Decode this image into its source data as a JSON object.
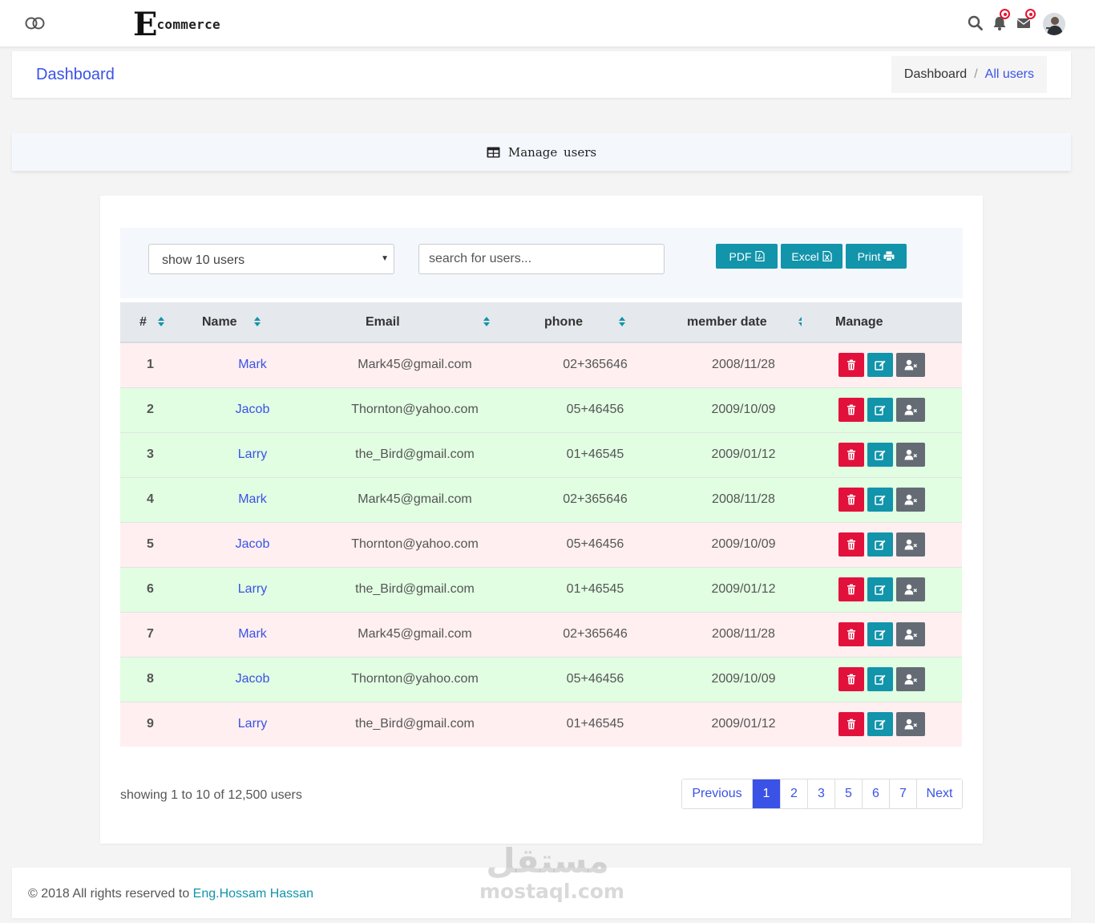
{
  "header": {
    "logo_letter": "E",
    "logo_text": "commerce",
    "icons": [
      "toggle-icon",
      "search-icon",
      "bell-icon",
      "envelope-icon",
      "avatar"
    ]
  },
  "titlebar": {
    "title": "Dashboard",
    "breadcrumb": {
      "home": "Dashboard",
      "separator": "/",
      "current": "All users"
    }
  },
  "section": {
    "title": "Manage users",
    "icon": "table-icon"
  },
  "controls": {
    "select_value": "show 10 users",
    "search_placeholder": "search for users...",
    "pdf_label": "PDF",
    "excel_label": "Excel",
    "print_label": "Print"
  },
  "table": {
    "columns": [
      "#",
      "Name",
      "Email",
      "phone",
      "member date",
      "Manage"
    ],
    "rows": [
      {
        "num": "1",
        "name": "Mark",
        "email": "Mark45@gmail.com",
        "phone": "02+365646",
        "date": "2008/11/28",
        "tint": "pink"
      },
      {
        "num": "2",
        "name": "Jacob",
        "email": "Thornton@yahoo.com",
        "phone": "05+46456",
        "date": "2009/10/09",
        "tint": "green"
      },
      {
        "num": "3",
        "name": "Larry",
        "email": "the_Bird@gmail.com",
        "phone": "01+46545",
        "date": "2009/01/12",
        "tint": "green"
      },
      {
        "num": "4",
        "name": "Mark",
        "email": "Mark45@gmail.com",
        "phone": "02+365646",
        "date": "2008/11/28",
        "tint": "green"
      },
      {
        "num": "5",
        "name": "Jacob",
        "email": "Thornton@yahoo.com",
        "phone": "05+46456",
        "date": "2009/10/09",
        "tint": "pink"
      },
      {
        "num": "6",
        "name": "Larry",
        "email": "the_Bird@gmail.com",
        "phone": "01+46545",
        "date": "2009/01/12",
        "tint": "green"
      },
      {
        "num": "7",
        "name": "Mark",
        "email": "Mark45@gmail.com",
        "phone": "02+365646",
        "date": "2008/11/28",
        "tint": "pink"
      },
      {
        "num": "8",
        "name": "Jacob",
        "email": "Thornton@yahoo.com",
        "phone": "05+46456",
        "date": "2009/10/09",
        "tint": "green"
      },
      {
        "num": "9",
        "name": "Larry",
        "email": "the_Bird@gmail.com",
        "phone": "01+46545",
        "date": "2009/01/12",
        "tint": "pink"
      }
    ]
  },
  "pagination": {
    "showing": "showing 1 to 10 of 12,500 users",
    "previous": "Previous",
    "pages": [
      "1",
      "2",
      "3",
      "5",
      "6",
      "7"
    ],
    "active_page": "1",
    "next": "Next"
  },
  "footer": {
    "text": "© 2018 All rights reserved to ",
    "author": "Eng.Hossam Hassan"
  },
  "watermark": {
    "arabic": "مستقل",
    "latin": "mostaql.com"
  },
  "colors": {
    "primary": "#3a52e6",
    "teal": "#1294ab",
    "danger": "#e2113c",
    "secondary": "#646b74",
    "row_pink": "#ffeff0",
    "row_green": "#e1fde2"
  }
}
